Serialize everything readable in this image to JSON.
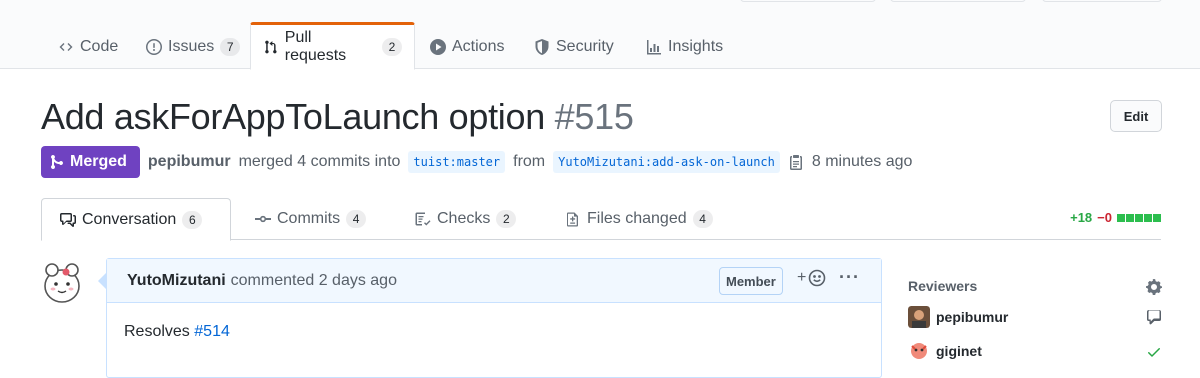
{
  "repo_nav": {
    "tabs": [
      {
        "label": "Code",
        "icon": "code-icon"
      },
      {
        "label": "Issues",
        "icon": "issue-opened-icon",
        "count": "7"
      },
      {
        "label": "Pull requests",
        "icon": "git-pull-request-icon",
        "count": "2",
        "selected": true
      },
      {
        "label": "Actions",
        "icon": "play-icon"
      },
      {
        "label": "Security",
        "icon": "shield-icon"
      },
      {
        "label": "Insights",
        "icon": "graph-icon"
      }
    ]
  },
  "pr": {
    "title": "Add askForAppToLaunch option",
    "number": "#515",
    "edit_label": "Edit",
    "state": "Merged",
    "state_color": "#6f42c1",
    "author": "pepibumur",
    "merged_text": "merged 4 commits into",
    "base_branch": "tuist:master",
    "from_text": "from",
    "head_branch": "YutoMizutani:add-ask-on-launch",
    "time": "8 minutes ago"
  },
  "pr_tabs": [
    {
      "label": "Conversation",
      "count": "6",
      "icon": "comment-discussion-icon",
      "selected": true
    },
    {
      "label": "Commits",
      "count": "4",
      "icon": "git-commit-icon"
    },
    {
      "label": "Checks",
      "count": "2",
      "icon": "checklist-icon"
    },
    {
      "label": "Files changed",
      "count": "4",
      "icon": "file-diff-icon"
    }
  ],
  "diffstat": {
    "additions": "+18",
    "deletions": "−0"
  },
  "comment": {
    "author": "YutoMizutani",
    "action": "commented 2 days ago",
    "badge": "Member",
    "reaction_symbol": "+",
    "more_symbol": "···",
    "body_text": "Resolves",
    "body_link": "#514"
  },
  "sidebar": {
    "reviewers_heading": "Reviewers",
    "reviewers": [
      {
        "name": "pepibumur",
        "status_icon": "comment-icon"
      },
      {
        "name": "giginet",
        "status_icon": "check-icon"
      }
    ]
  }
}
